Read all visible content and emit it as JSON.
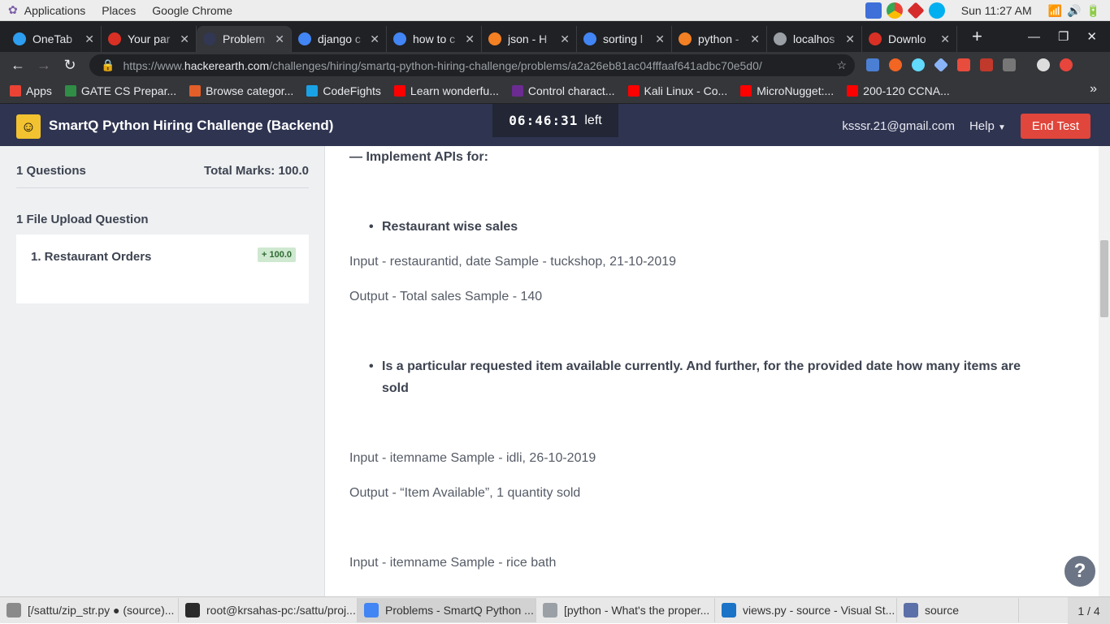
{
  "system_bar": {
    "menus": [
      "Applications",
      "Places",
      "Google Chrome"
    ],
    "clock": "Sun 11:27 AM"
  },
  "tabs": [
    {
      "title": "OneTab",
      "color": "#2d9ef0"
    },
    {
      "title": "Your par",
      "color": "#d93025"
    },
    {
      "title": "Problem",
      "color": "#323754"
    },
    {
      "title": "django c",
      "color": "#4285f4"
    },
    {
      "title": "how to c",
      "color": "#4285f4"
    },
    {
      "title": "json - H",
      "color": "#f48024"
    },
    {
      "title": "sorting l",
      "color": "#4285f4"
    },
    {
      "title": "python -",
      "color": "#f48024"
    },
    {
      "title": "localhos",
      "color": "#9aa0a6"
    },
    {
      "title": "Downlo",
      "color": "#d93025"
    }
  ],
  "address_bar": {
    "prefix": "https://www.",
    "host": "hackerearth.com",
    "path": "/challenges/hiring/smartq-python-hiring-challenge/problems/a2a26eb81ac04fffaaf641adbc70e5d0/"
  },
  "bookmarks": [
    {
      "label": "Apps",
      "color": "#ea4335"
    },
    {
      "label": "GATE CS Prepar...",
      "color": "#2f8d46"
    },
    {
      "label": "Browse categor...",
      "color": "#e35f2a"
    },
    {
      "label": "CodeFights",
      "color": "#1aa2e6"
    },
    {
      "label": "Learn wonderfu...",
      "color": "#ff0000"
    },
    {
      "label": "Control charact...",
      "color": "#6b2c91"
    },
    {
      "label": "Kali Linux - Co...",
      "color": "#ff0000"
    },
    {
      "label": "MicroNugget:...",
      "color": "#ff0000"
    },
    {
      "label": "200-120 CCNA...",
      "color": "#ff0000"
    }
  ],
  "header": {
    "title": "SmartQ Python Hiring Challenge (Backend)",
    "timer": "06:46:31",
    "timer_suffix": "left",
    "email": "ksssr.21@gmail.com",
    "help_label": "Help",
    "end_test_label": "End Test"
  },
  "sidebar": {
    "questions_count": "1 Questions",
    "total_marks": "Total Marks: 100.0",
    "section_title": "1 File Upload Question",
    "question": {
      "title": "1. Restaurant Orders",
      "marks": "+ 100.0"
    }
  },
  "content": {
    "heading": "— Implement APIs for:",
    "bullet1": "Restaurant wise sales",
    "input1": "Input - restaurantid, date Sample - tuckshop, 21-10-2019",
    "output1": "Output - Total sales Sample - 140",
    "bullet2_line1": "Is a particular requested item available currently. And further, for the provided date how many items are",
    "bullet2_line2": "sold",
    "input2": "Input - itemname Sample - idli, 26-10-2019",
    "output2": "Output - “Item Available”, 1 quantity sold",
    "input3": "Input - itemname Sample - rice bath"
  },
  "taskbar": {
    "items": [
      {
        "label": "[/sattu/zip_str.py ● (source)...",
        "color": "#8a8a8a"
      },
      {
        "label": "root@krsahas-pc:/sattu/proj...",
        "color": "#2b2b2b"
      },
      {
        "label": "Problems - SmartQ Python ...",
        "color": "#4285f4"
      },
      {
        "label": "[python - What's the proper...",
        "color": "#9aa0a6"
      },
      {
        "label": "views.py - source - Visual St...",
        "color": "#1a73c7"
      },
      {
        "label": "source",
        "color": "#5b6fa8"
      }
    ],
    "pager": "1 / 4"
  }
}
